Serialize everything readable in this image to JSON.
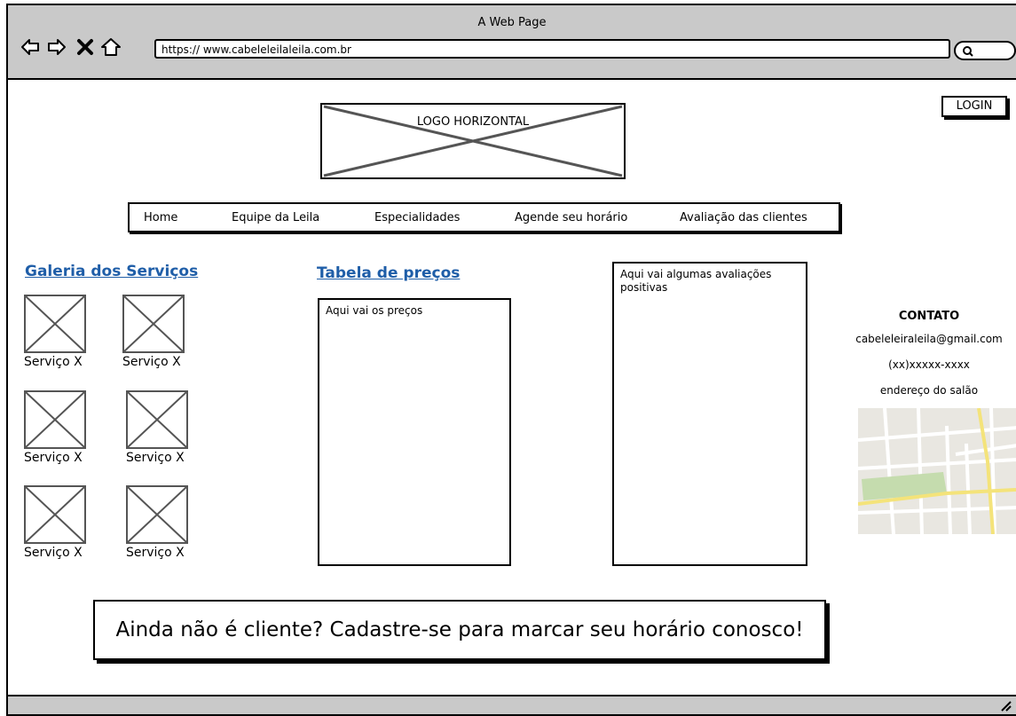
{
  "browser": {
    "window_title": "A Web Page",
    "url": "https:// www.cabeleleilaleila.com.br",
    "icons": [
      "back-arrow-icon",
      "forward-arrow-icon",
      "close-icon",
      "home-icon",
      "search-icon"
    ]
  },
  "header": {
    "logo_text": "LOGO HORIZONTAL",
    "login_label": "LOGIN"
  },
  "nav": {
    "items": [
      {
        "label": "Home"
      },
      {
        "label": "Equipe da Leila"
      },
      {
        "label": "Especialidades"
      },
      {
        "label": "Agende seu horário"
      },
      {
        "label": "Avaliação das clientes"
      }
    ]
  },
  "gallery": {
    "title": "Galeria dos Serviços",
    "items": [
      {
        "label": "Serviço X"
      },
      {
        "label": "Serviço X"
      },
      {
        "label": "Serviço X"
      },
      {
        "label": "Serviço X"
      },
      {
        "label": "Serviço X"
      },
      {
        "label": "Serviço X"
      }
    ]
  },
  "prices": {
    "title": "Tabela de preços",
    "body": "Aqui vai os preços"
  },
  "reviews": {
    "body": "Aqui vai algumas avaliações positivas"
  },
  "contact": {
    "title": "CONTATO",
    "email": "cabeleleiraleila@gmail.com",
    "phone": "(xx)xxxxx-xxxx",
    "address": "endereço do salão"
  },
  "cta": {
    "text": "Ainda não é cliente? Cadastre-se para marcar seu horário conosco!"
  },
  "colors": {
    "chrome": "#c9c9c9",
    "heading_link": "#1f5ea8",
    "map_bg": "#e9e7e1",
    "map_road_yellow": "#f4e37a",
    "map_park": "#c5dcae"
  }
}
